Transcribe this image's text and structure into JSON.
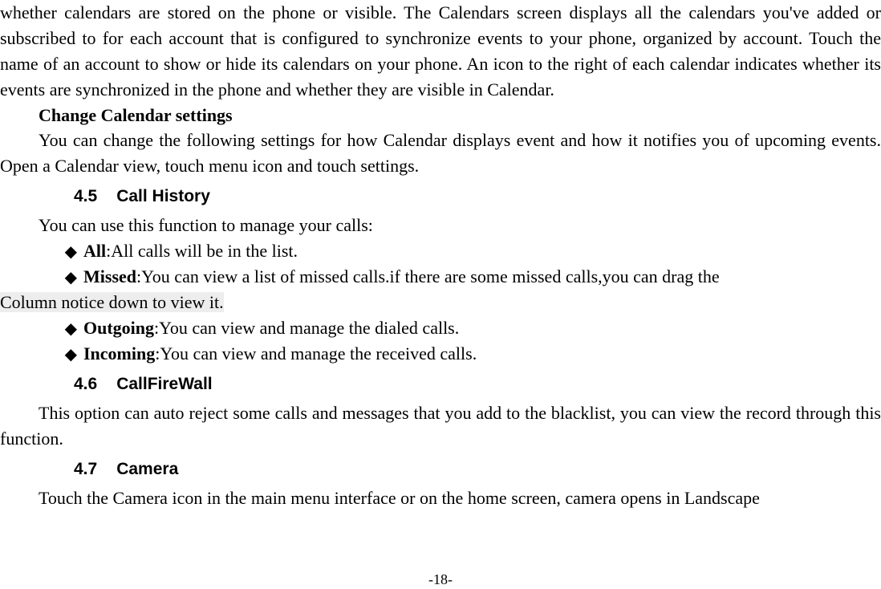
{
  "paragraphs": {
    "intro": "whether calendars are stored on the phone or visible. The Calendars screen displays all the calendars you've added or subscribed to for each account that is configured to synchronize events to your phone, organized by account. Touch the name of an account to show or hide its calendars on your phone. An icon to the right of each calendar indicates whether its events are synchronized in the phone and whether they are visible in Calendar.",
    "change_heading": "Change Calendar settings",
    "change_body": "You can change the following settings for how Calendar displays event and how it notifies you of upcoming events. Open a Calendar view, touch menu icon and touch settings.",
    "call_history_intro": "You can use this function to manage your calls:",
    "firewall_body": "This option can auto reject some calls and messages that you add to the blacklist, you can view the record through this function.",
    "camera_body": "Touch the Camera icon in the main menu interface or on the home screen, camera opens in Landscape"
  },
  "bullets": {
    "all_label": "All",
    "all_text": ":All calls will be in the list.",
    "missed_label": "Missed",
    "missed_text_pre": ":You can view a list of missed calls.if there are some missed calls,you can drag the ",
    "missed_text_line2": "Column notice down to view it.",
    "outgoing_label": "Outgoing",
    "outgoing_text": ":You can view and manage the dialed calls.",
    "incoming_label": "Incoming",
    "incoming_text": ":You can view and manage the received calls."
  },
  "sections": {
    "s45_num": "4.5",
    "s45_title": "Call History",
    "s46_num": "4.6",
    "s46_title": "CallFireWall",
    "s47_num": "4.7",
    "s47_title": "Camera"
  },
  "page_number": "-18-",
  "diamond": "◆"
}
